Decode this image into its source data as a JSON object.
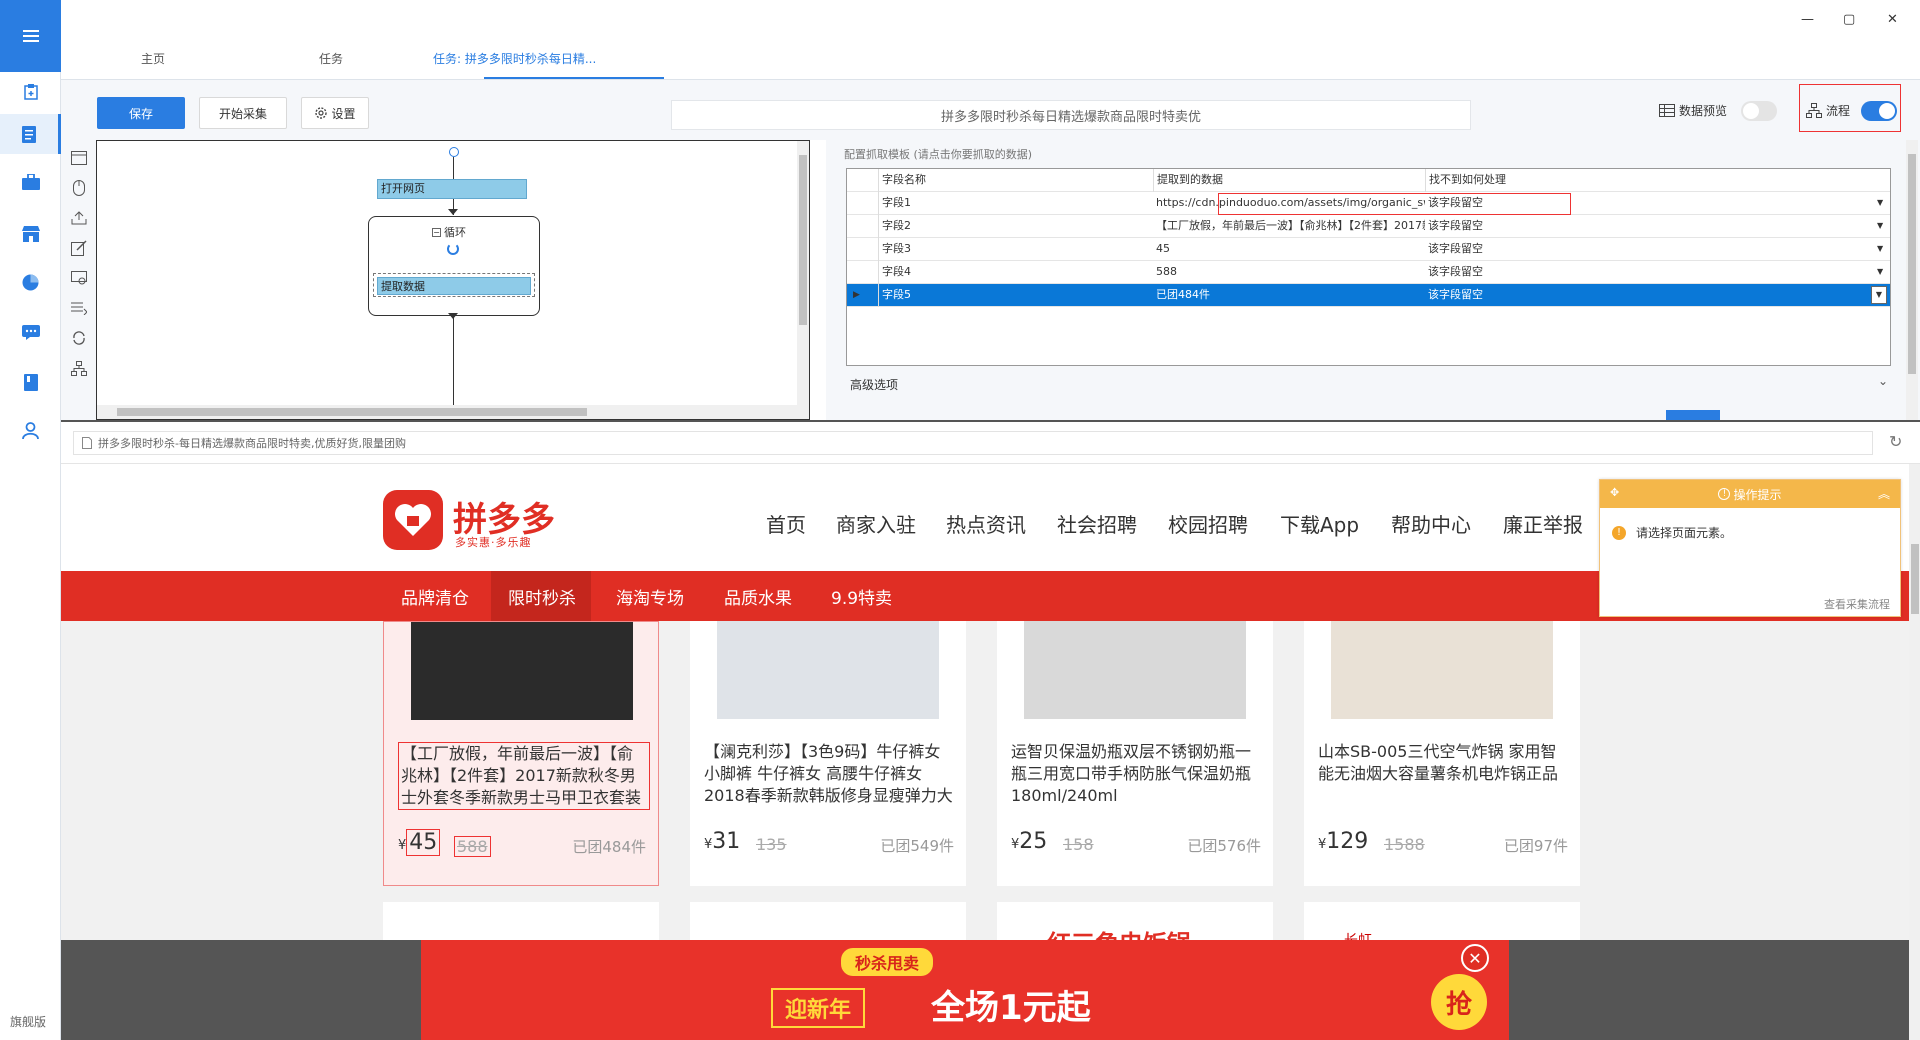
{
  "sidebar": {
    "edition_label": "旗舰版",
    "icons": [
      "task-new-icon",
      "task-list-icon",
      "briefcase-icon",
      "store-icon",
      "chart-pie-icon",
      "chat-icon",
      "book-icon",
      "user-icon"
    ]
  },
  "tabs": [
    {
      "label": "主页"
    },
    {
      "label": "任务"
    },
    {
      "label": "任务: 拼多多限时秒杀每日精..."
    }
  ],
  "window_controls": {
    "minimize": "—",
    "maximize": "▢",
    "close": "✕"
  },
  "toolbar": {
    "save_label": "保存",
    "start_label": "开始采集",
    "settings_label": "设置",
    "task_title": "拼多多限时秒杀每日精选爆款商品限时特卖优",
    "data_preview_label": "数据预览",
    "flow_label": "流程",
    "data_preview_on": false,
    "flow_on": true
  },
  "flow": {
    "open_page_label": "打开网页",
    "loop_label": "循环",
    "extract_label": "提取数据"
  },
  "config": {
    "hint": "配置抓取模板 (请点击你要抓取的数据)",
    "headers": [
      "字段名称",
      "提取到的数据",
      "找不到如何处理"
    ],
    "rows": [
      {
        "name": "字段1",
        "value": "https://cdn.pinduoduo.com/assets/img/organic_swee...",
        "action": "该字段留空"
      },
      {
        "name": "字段2",
        "value": "【工厂放假，年前最后一波】【俞兆林】【2件套】2017新...",
        "action": "该字段留空"
      },
      {
        "name": "字段3",
        "value": "45",
        "action": "该字段留空"
      },
      {
        "name": "字段4",
        "value": "588",
        "action": "该字段留空"
      },
      {
        "name": "字段5",
        "value": "已团484件",
        "action": "该字段留空"
      }
    ],
    "selected_row": 4,
    "advanced_label": "高级选项"
  },
  "address": {
    "url_text": "拼多多限时秒杀-每日精选爆款商品限时特卖,优质好货,限量团购"
  },
  "site": {
    "logo_text": "拼多多",
    "logo_sub": "多实惠·多乐趣",
    "top_nav": [
      "首页",
      "商家入驻",
      "热点资讯",
      "社会招聘",
      "校园招聘",
      "下载App",
      "帮助中心",
      "廉正举报"
    ],
    "red_nav": [
      "品牌清仓",
      "限时秒杀",
      "海淘专场",
      "品质水果",
      "9.9特卖"
    ],
    "red_nav_active": 1,
    "products": [
      {
        "title": "【工厂放假，年前最后一波】【俞兆林】【2件套】2017新款秋冬男士外套冬季新款男士马甲卫衣套装",
        "currency": "¥",
        "price": "45",
        "orig": "588",
        "sold": "已团484件"
      },
      {
        "title": "【澜克利莎】【3色9码】牛仔裤女小脚裤 牛仔裤女 高腰牛仔裤女2018春季新款韩版修身显瘦弹力大",
        "currency": "¥",
        "price": "31",
        "orig": "135",
        "sold": "已团549件"
      },
      {
        "title": "运智贝保温奶瓶双层不锈钢奶瓶一瓶三用宽口带手柄防胀气保温奶瓶180ml/240ml",
        "currency": "¥",
        "price": "25",
        "orig": "158",
        "sold": "已团576件"
      },
      {
        "title": "山本SB-005三代空气炸锅 家用智能无油烟大容量薯条机电炸锅正品",
        "currency": "¥",
        "price": "129",
        "orig": "1588",
        "sold": "已团97件"
      }
    ],
    "second_row_texts": [
      "红三角电饭锅",
      "长虹"
    ],
    "banner": {
      "tag": "秒杀甩卖",
      "left": "迎新年",
      "main": "全场1元起",
      "grab": "抢"
    }
  },
  "tips": {
    "title": "操作提示",
    "message": "请选择页面元素。",
    "link": "查看采集流程"
  },
  "colors": {
    "accent": "#2a7de1",
    "pdd_red": "#e02e24",
    "tip_orange": "#f4b74a"
  }
}
